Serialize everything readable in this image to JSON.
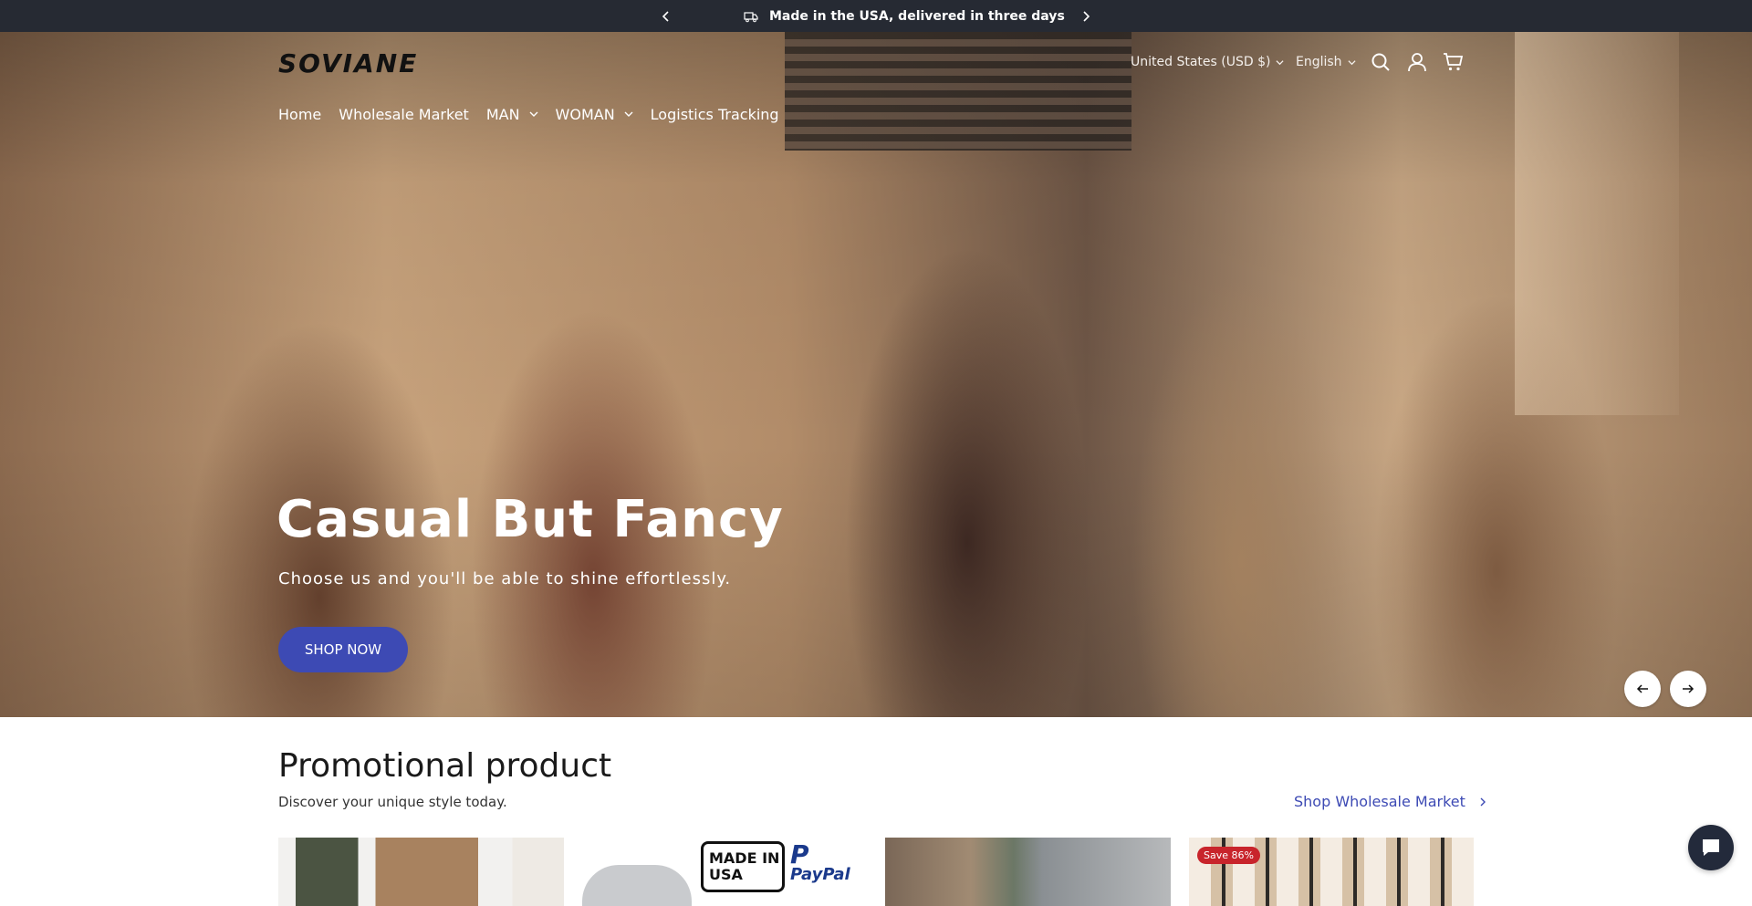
{
  "announcement": {
    "message": "Made in the USA, delivered in three days"
  },
  "header": {
    "logo": "SOVIANE",
    "currency": "United States (USD $)",
    "language": "English"
  },
  "nav": {
    "items": [
      {
        "label": "Home"
      },
      {
        "label": "Wholesale Market"
      },
      {
        "label": "MAN"
      },
      {
        "label": "WOMAN"
      },
      {
        "label": "Logistics Tracking"
      }
    ]
  },
  "hero": {
    "title": "Casual But Fancy",
    "subtitle": "Choose us and you'll be able to shine effortlessly.",
    "button": "SHOP NOW"
  },
  "promo": {
    "title": "Promotional product",
    "subtitle": "Discover your unique style today.",
    "link": "Shop Wholesale Market",
    "card2": {
      "badge_line1": "MADE IN",
      "badge_line2": "USA",
      "paypal_letter": "P",
      "paypal_text": "PayPal"
    },
    "card4": {
      "save_badge": "Save 86%"
    }
  },
  "colors": {
    "accent": "#3d4ab4",
    "announcement_bg": "#262a33",
    "sale": "#c8242b"
  }
}
